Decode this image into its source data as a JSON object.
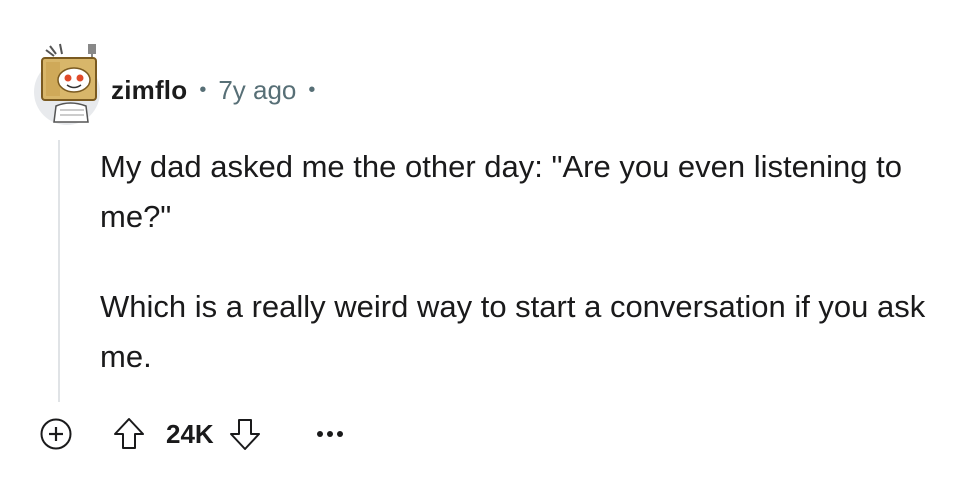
{
  "comment": {
    "author": "zimflo",
    "separator": "•",
    "timestamp": "7y ago",
    "paragraphs": [
      "My dad asked me the other day: \"Are you even listening to me?\"",
      "Which is a really weird way to start a conversation if you ask me."
    ],
    "score": "24K"
  },
  "icons": {
    "avatar": "snoo-avatar-icon",
    "expand": "plus-circle-icon",
    "upvote": "upvote-arrow-icon",
    "downvote": "downvote-arrow-icon",
    "more": "more-options-icon"
  },
  "colors": {
    "text": "#1a1a1b",
    "meta": "#576f76",
    "thread_line": "#e0e3e6"
  }
}
